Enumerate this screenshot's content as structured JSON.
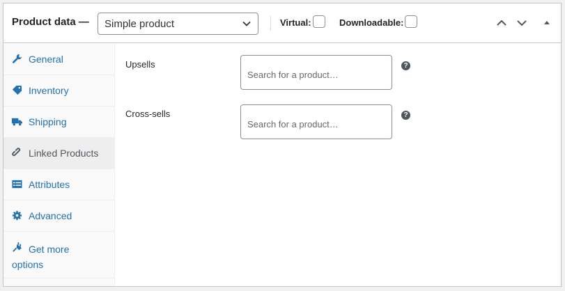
{
  "header": {
    "title": "Product data",
    "title_dash": "—",
    "product_type": "Simple product",
    "virtual_label": "Virtual:",
    "downloadable_label": "Downloadable:"
  },
  "icons": {
    "move_up": "chevron-up-icon",
    "move_down": "chevron-down-icon",
    "collapse": "triangle-up-icon"
  },
  "tabs": [
    {
      "label": "General",
      "icon": "wrench-icon"
    },
    {
      "label": "Inventory",
      "icon": "tag-icon"
    },
    {
      "label": "Shipping",
      "icon": "truck-icon"
    },
    {
      "label": "Linked Products",
      "icon": "link-icon",
      "active": true
    },
    {
      "label": "Attributes",
      "icon": "list-icon"
    },
    {
      "label": "Advanced",
      "icon": "gear-icon"
    },
    {
      "label": "Get more options",
      "icon": "plug-icon"
    }
  ],
  "fields": {
    "upsells_label": "Upsells",
    "upsells_placeholder": "Search for a product…",
    "crosssells_label": "Cross-sells",
    "crosssells_placeholder": "Search for a product…",
    "help_glyph": "?"
  },
  "colors": {
    "link": "#2271b1",
    "active_tab_bg": "#eeeeee",
    "border": "#c3c4c7"
  }
}
